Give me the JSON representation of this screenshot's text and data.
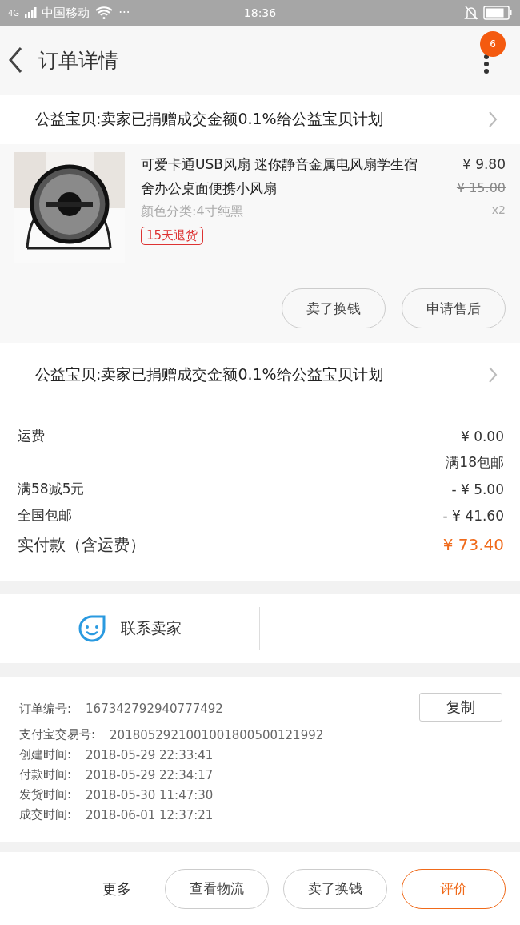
{
  "status_bar": {
    "network": "4G",
    "carrier": "中国移动",
    "more": "···",
    "time": "18:36"
  },
  "header": {
    "title": "订单详情",
    "badge": "6"
  },
  "charity_top": {
    "text": "公益宝贝:卖家已捐赠成交金额0.1%给公益宝贝计划"
  },
  "product": {
    "picture": {
      "kind": "picture"
    },
    "name": "可爱卡通USB风扇 迷你静音金属电风扇学生宿舍办公桌面便携小风扇",
    "sku": "颜色分类:4寸纯黑",
    "price": "¥ 9.80",
    "original_price": "¥ 15.00",
    "quantity": "x2",
    "tag": "15天退货",
    "buttons": [
      "卖了换钱",
      "申请售后"
    ]
  },
  "charity_bottom": {
    "text": "公益宝贝:卖家已捐赠成交金额0.1%给公益宝贝计划"
  },
  "costs": [
    {
      "kind": "line",
      "label": "运费",
      "value": "¥ 0.00"
    },
    {
      "kind": "note",
      "value": "满18包邮"
    },
    {
      "kind": "line",
      "label": "满58减5元",
      "value": "- ¥ 5.00"
    },
    {
      "kind": "line",
      "label": "全国包邮",
      "value": "- ¥ 41.60"
    },
    {
      "kind": "total",
      "label": "实付款（含运费）",
      "value": "¥ 73.40"
    }
  ],
  "contact": {
    "label": "联系卖家"
  },
  "order_info": {
    "copy_button": "复制",
    "rows": [
      {
        "label": "订单编号:",
        "value": "167342792940777492"
      },
      {
        "label": "支付宝交易号:",
        "value": "2018052921001001800500121992"
      },
      {
        "label": "创建时间:",
        "value": "2018-05-29 22:33:41"
      },
      {
        "label": "付款时间:",
        "value": "2018-05-29 22:34:17"
      },
      {
        "label": "发货时间:",
        "value": "2018-05-30 11:47:30"
      },
      {
        "label": "成交时间:",
        "value": "2018-06-01 12:37:21"
      }
    ]
  },
  "bottom_bar": {
    "more": "更多",
    "buttons": [
      {
        "label": "查看物流",
        "kind": "plain"
      },
      {
        "label": "卖了换钱",
        "kind": "plain"
      },
      {
        "label": "评价",
        "kind": "primary"
      }
    ]
  }
}
